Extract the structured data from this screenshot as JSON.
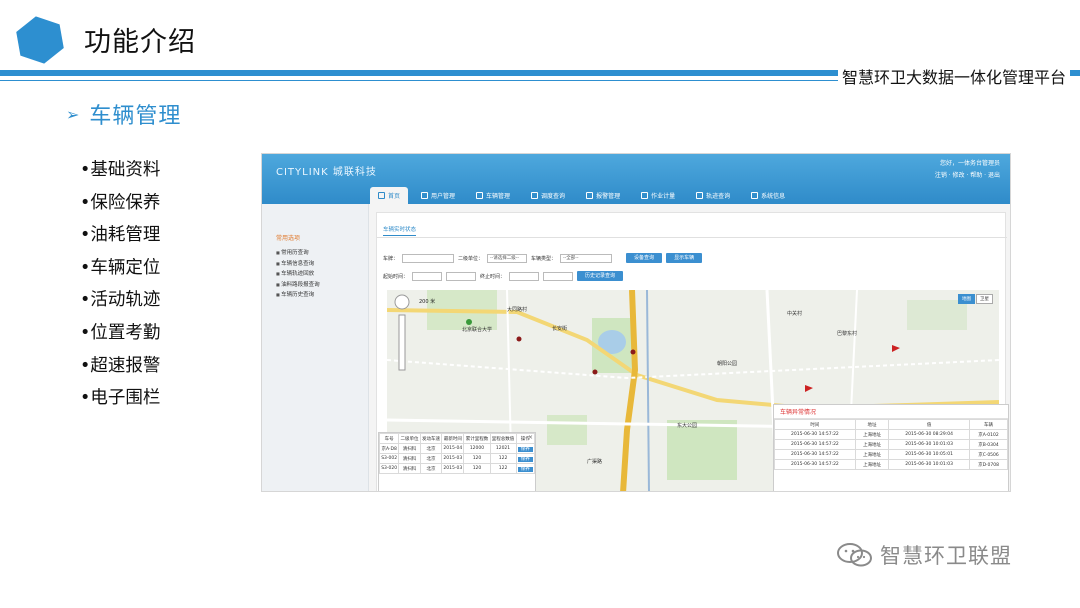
{
  "slide": {
    "title": "功能介绍",
    "platform": "智慧环卫大数据一体化管理平台",
    "section_arrow": "➢",
    "section": "车辆管理",
    "features": [
      "•基础资料",
      "•保险保养",
      "•油耗管理",
      "•车辆定位",
      "•活动轨迹",
      "•位置考勤",
      "•超速报警",
      "•电子围栏"
    ],
    "watermark": "智慧环卫联盟"
  },
  "app": {
    "logo": "CITYLINK 城联科技",
    "user_line1": "您好，一体务台管理员",
    "user_line2": "注销 · 修改 · 帮助 · 退出",
    "nav": [
      "首页",
      "用户管理",
      "车辆管理",
      "调度查询",
      "报警管理",
      "作业计量",
      "轨迹查询",
      "系统信息"
    ],
    "sidebar": {
      "title": "常用选项",
      "items": [
        "常用历查询",
        "车辆信息查询",
        "车辆轨迹回放",
        "油料路段报查询",
        "车辆历史查询"
      ]
    },
    "breadcrumb": "车辆实时状态",
    "filters": {
      "row1": {
        "plate_label": "车牌：",
        "company_label": "二级单位：",
        "company_value": "--请选择二级--",
        "type_label": "车辆类型：",
        "type_value": "--全部--",
        "btn_query": "设备查询",
        "btn_show": "显示车辆"
      },
      "row2": {
        "start_label": "起始时间：",
        "end_label": "终止时间：",
        "btn_history": "历史记录查询"
      }
    },
    "map": {
      "scale": "200 米",
      "types": [
        "地图",
        "卫星"
      ],
      "labels": [
        "大同路村",
        "北京联合大学",
        "长安街",
        "东大公园",
        "巴黎东村",
        "中关村",
        "朝阳公园",
        "广渠路"
      ]
    },
    "vehicle_table": {
      "headers": [
        "车号",
        "二级单位",
        "发动车速",
        "最新时间",
        "累计里程数",
        "里程总数值",
        "操作"
      ],
      "rows": [
        [
          "京A·D8",
          "清扫科",
          "北京",
          "2015-04",
          "12000",
          "12021",
          "保养"
        ],
        [
          "S3-002",
          "清扫科",
          "北京",
          "2015-03",
          "120",
          "122",
          "保养"
        ],
        [
          "S3-020",
          "清扫科",
          "北京",
          "2015-03",
          "120",
          "122",
          "保养"
        ]
      ]
    },
    "alarm_table": {
      "title": "车辆异常情况",
      "headers": [
        "时间",
        "地址",
        "值",
        "车辆"
      ],
      "rows": [
        [
          "2015-06-30 14:57:22",
          "上海地址",
          "2015-06-30 08:29:04",
          "京A·0102"
        ],
        [
          "2015-06-30 14:57:22",
          "上海地址",
          "2015-06-30 10:01:03",
          "京B·0304"
        ],
        [
          "2015-06-30 14:57:22",
          "上海地址",
          "2015-06-30 10:05:01",
          "京C·0506"
        ],
        [
          "2015-06-30 14:57:22",
          "上海地址",
          "2015-06-30 10:01:03",
          "京D·0708"
        ]
      ]
    }
  },
  "colors": {
    "accent": "#2d8fd0",
    "section": "#2e8ece",
    "header": "#3b8fd0",
    "alert": "#d33333"
  }
}
